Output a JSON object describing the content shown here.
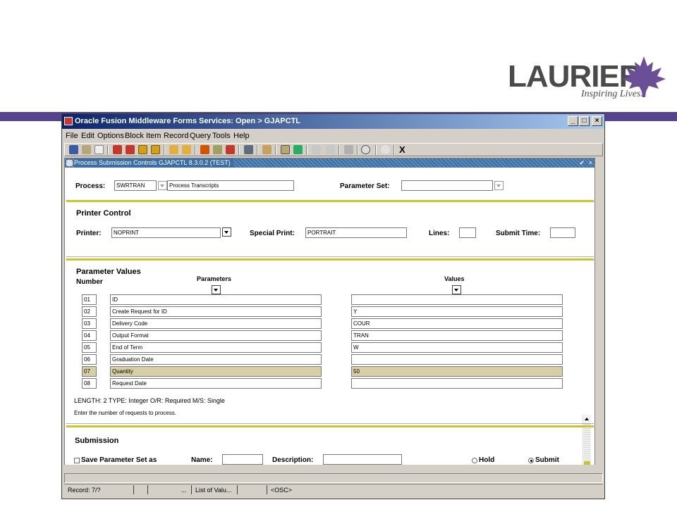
{
  "branding": {
    "logo_text": "LAURIER",
    "tagline": "Inspiring Lives."
  },
  "window": {
    "title": "Oracle Fusion Middleware Forms Services:  Open > GJAPCTL",
    "controls": [
      "minimize",
      "maximize",
      "close"
    ]
  },
  "menu": [
    "File",
    "Edit",
    "Options",
    "Block",
    "Item",
    "Record",
    "Query",
    "Tools",
    "Help"
  ],
  "toolbar": {
    "exit_label": "X"
  },
  "form": {
    "title": "Process Submission Controls  GJAPCTL  8.3.0.2  (TEST)",
    "process": {
      "label": "Process:",
      "code": "SWRTRAN",
      "description": "Process Transcripts"
    },
    "parameter_set": {
      "label": "Parameter Set:",
      "value": ""
    },
    "printer_control": {
      "title": "Printer Control",
      "printer_label": "Printer:",
      "printer_value": "NOPRINT",
      "special_print_label": "Special Print:",
      "special_print_value": "PORTRAIT",
      "lines_label": "Lines:",
      "lines_value": "",
      "submit_time_label": "Submit Time:",
      "submit_time_value": ""
    },
    "parameter_values": {
      "title": "Parameter Values",
      "number_header": "Number",
      "parameters_header": "Parameters",
      "values_header": "Values",
      "rows": [
        {
          "number": "01",
          "parameter": "ID",
          "value": "",
          "selected": false
        },
        {
          "number": "02",
          "parameter": "Create Request for ID",
          "value": "Y",
          "selected": false
        },
        {
          "number": "03",
          "parameter": "Delivery Code",
          "value": "COUR",
          "selected": false
        },
        {
          "number": "04",
          "parameter": "Output Format",
          "value": "TRAN",
          "selected": false
        },
        {
          "number": "05",
          "parameter": "End of Term",
          "value": "W",
          "selected": false
        },
        {
          "number": "06",
          "parameter": "Graduation Date",
          "value": "",
          "selected": false
        },
        {
          "number": "07",
          "parameter": "Quantity",
          "value": "50",
          "selected": true
        },
        {
          "number": "08",
          "parameter": "Request Date",
          "value": "",
          "selected": false
        }
      ],
      "info_line": "LENGTH: 2 TYPE: Integer O/R: Required M/S: Single",
      "help_line": "Enter the number of requests to process."
    },
    "submission": {
      "title": "Submission",
      "save_label": "Save Parameter Set as",
      "name_label": "Name:",
      "name_value": "",
      "description_label": "Description:",
      "description_value": "",
      "hold_label": "Hold",
      "submit_label": "Submit",
      "selected_option": "Submit"
    }
  },
  "status_bar": {
    "record": "Record: 7/?",
    "field3": "...",
    "list_of_values": "List of Valu...",
    "osc": "<OSC>"
  },
  "colors": {
    "accent_purple": "#56438d",
    "section_rule": "#c8c530",
    "selected_row": "#d6cfa6",
    "title_blue": "#0a246a"
  }
}
